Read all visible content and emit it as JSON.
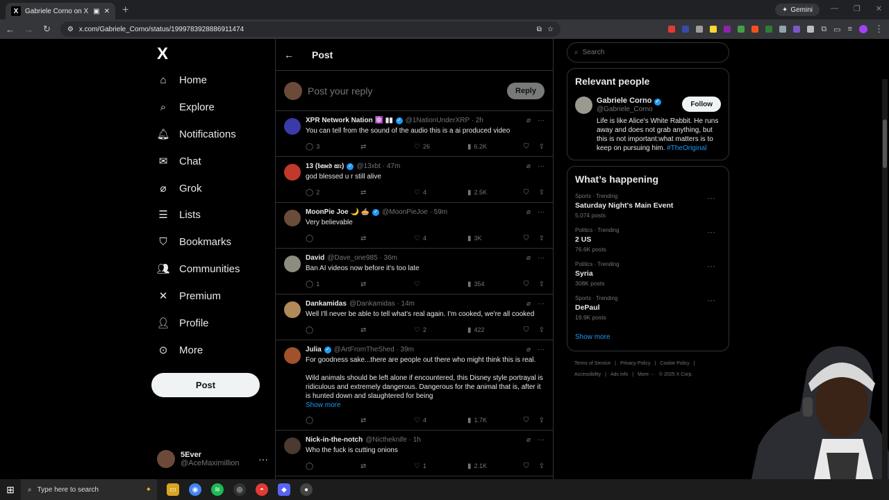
{
  "browser": {
    "tab_title": "Gabriele Corno on X: \"Angr",
    "tab_favicon": "x-logo",
    "new_tab": "+",
    "gemini_label": "Gemini",
    "url": "x.com/Gabriele_Corno/status/1999783928886911474",
    "window_controls": [
      "—",
      "❐",
      "✕"
    ]
  },
  "nav": {
    "logo": "X",
    "items": [
      {
        "label": "Home",
        "icon": "home-icon",
        "glyph": "⌂"
      },
      {
        "label": "Explore",
        "icon": "search-icon",
        "glyph": "⌕"
      },
      {
        "label": "Notifications",
        "icon": "bell-icon",
        "glyph": "🔔︎"
      },
      {
        "label": "Chat",
        "icon": "mail-icon",
        "glyph": "✉"
      },
      {
        "label": "Grok",
        "icon": "grok-icon",
        "glyph": "⌀"
      },
      {
        "label": "Lists",
        "icon": "lists-icon",
        "glyph": "☰"
      },
      {
        "label": "Bookmarks",
        "icon": "bookmark-icon",
        "glyph": "⛉"
      },
      {
        "label": "Communities",
        "icon": "communities-icon",
        "glyph": "👥︎"
      },
      {
        "label": "Premium",
        "icon": "x-premium-icon",
        "glyph": "✕"
      },
      {
        "label": "Profile",
        "icon": "profile-icon",
        "glyph": "👤︎"
      },
      {
        "label": "More",
        "icon": "more-circle-icon",
        "glyph": "⊙"
      }
    ],
    "post_button": "Post",
    "account": {
      "name": "5Ever",
      "handle": "@AceMaximillion"
    }
  },
  "header": {
    "title": "Post"
  },
  "reply": {
    "placeholder": "Post your reply",
    "button": "Reply"
  },
  "tweets": [
    {
      "name": "XPR Network Nation ⚛️ ▮▮",
      "verified": true,
      "handle": "@1NationUnderXRP · 2h",
      "text": "You can tell from the sound of the audio this is a ai produced video",
      "replies": "3",
      "retweets": "",
      "likes": "26",
      "views": "6.2K",
      "avatar_color": "#3a3aa8"
    },
    {
      "name": "13 (𝔟𝔞𝔰𝔢𝔡 𝔞𝔯𝔠)",
      "verified": true,
      "handle": "@13xbt · 47m",
      "text": "god blessed u r still alive",
      "replies": "2",
      "retweets": "",
      "likes": "4",
      "views": "2.5K",
      "avatar_color": "#c0392b"
    },
    {
      "name": "MoonPie Joe 🌙 🥧",
      "verified": true,
      "handle": "@MoonPieJoe · 59m",
      "text": "Very believable",
      "replies": "",
      "retweets": "",
      "likes": "4",
      "views": "3K",
      "avatar_color": "#6a4c3a"
    },
    {
      "name": "David",
      "verified": false,
      "handle": "@Dave_one985 · 36m",
      "text": "Ban AI videos now before it's too late",
      "replies": "1",
      "retweets": "",
      "likes": "",
      "views": "354",
      "avatar_color": "#8c8c80"
    },
    {
      "name": "Dankamidas",
      "verified": false,
      "handle": "@Dankamidas · 14m",
      "text": "Well I'll never be able to tell what's real again. I'm cooked, we're all cooked",
      "replies": "",
      "retweets": "",
      "likes": "2",
      "views": "422",
      "avatar_color": "#b08a5a"
    },
    {
      "name": "Julia",
      "verified": true,
      "handle": "@ArtFromTheShed · 39m",
      "text": "For goodness sake...there are people out there who might think this is real.\n\nWild animals should be left alone if encountered, this Disney style portrayal is ridiculous and extremely dangerous. Dangerous for the animal that is, after it is hunted down and slaughtered for being",
      "show_more": "Show more",
      "replies": "",
      "retweets": "",
      "likes": "4",
      "views": "1.7K",
      "avatar_color": "#a0522d"
    },
    {
      "name": "Nick-in-the-notch",
      "verified": false,
      "handle": "@Nictheknife · 1h",
      "text": "Who the fuck is cutting onions",
      "replies": "",
      "retweets": "",
      "likes": "1",
      "views": "2.1K",
      "avatar_color": "#4a3a30"
    }
  ],
  "search": {
    "placeholder": "Search"
  },
  "relevant": {
    "title": "Relevant people",
    "person": {
      "name": "Gabriele Corno",
      "handle": "@Gabriele_Corno",
      "follow": "Follow",
      "bio": "Life is like Alice's White Rabbit. He runs away and does not grab anything, but this is not important:what matters is to keep on pursuing him. ",
      "hashtag": "#TheOriginal"
    }
  },
  "happening": {
    "title": "What’s happening",
    "trends": [
      {
        "context": "Sports · Trending",
        "name": "Saturday Night's Main Event",
        "posts": "5,074 posts"
      },
      {
        "context": "Politics · Trending",
        "name": "2 US",
        "posts": "76.6K posts"
      },
      {
        "context": "Politics · Trending",
        "name": "Syria",
        "posts": "308K posts"
      },
      {
        "context": "Sports · Trending",
        "name": "DePaul",
        "posts": "19.9K posts"
      }
    ],
    "show_more": "Show more"
  },
  "footer": {
    "line1": [
      "Terms of Service",
      "|",
      "Privacy Policy",
      "|",
      "Cookie Policy",
      "|"
    ],
    "line2": [
      "Accessibility",
      "|",
      "Ads info",
      "|",
      "More ···",
      "© 2025 X Corp."
    ]
  },
  "taskbar": {
    "search_placeholder": "Type here to search"
  }
}
